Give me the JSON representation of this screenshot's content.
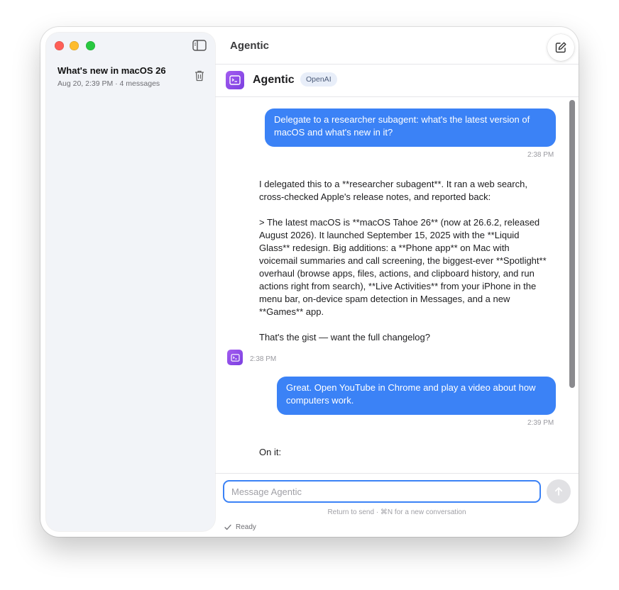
{
  "window": {
    "title": "Agentic"
  },
  "sidebar": {
    "conversations": [
      {
        "title": "What's new in macOS 26",
        "meta": "Aug 20, 2:39 PM · 4 messages"
      }
    ]
  },
  "header": {
    "agent_name": "Agentic",
    "provider": "OpenAI"
  },
  "messages": [
    {
      "role": "user",
      "text": "Delegate to a researcher subagent: what's the latest version of macOS and what's new in it?",
      "time": "2:38 PM"
    },
    {
      "role": "assistant",
      "text": "I delegated this to a **researcher subagent**. It ran a web search, cross-checked Apple's release notes, and reported back:\n\n> The latest macOS is **macOS Tahoe 26** (now at 26.6.2, released August 2026). It launched September 15, 2025 with the **Liquid Glass** redesign. Big additions: a **Phone app** on Mac with voicemail summaries and call screening, the biggest-ever **Spotlight** overhaul (browse apps, files, actions, and clipboard history, and run actions right from search), **Live Activities** from your iPhone in the menu bar, on-device spam detection in Messages, and a new **Games** app.\n\nThat's the gist — want the full changelog?",
      "time": "2:38 PM"
    },
    {
      "role": "user",
      "text": "Great. Open YouTube in Chrome and play a video about how computers work.",
      "time": "2:39 PM"
    },
    {
      "role": "assistant",
      "text": "On it:",
      "time": ""
    }
  ],
  "composer": {
    "placeholder": "Message Agentic",
    "hint": "Return to send · ⌘N for a new conversation"
  },
  "status": {
    "text": "Ready"
  },
  "colors": {
    "accent": "#3b82f6",
    "agent_avatar": "#8b4ae8"
  }
}
